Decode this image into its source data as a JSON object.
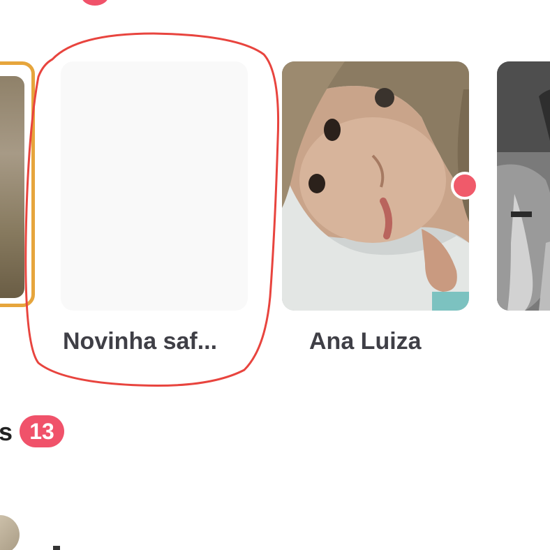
{
  "matches": {
    "cards": [
      {
        "name": "",
        "photo": "blurred-photo"
      },
      {
        "name": "Novinha saf...",
        "photo": "empty"
      },
      {
        "name": "Ana Luiza",
        "photo": "portrait-photo",
        "online": true
      },
      {
        "name": "",
        "photo": "monochrome-photo"
      }
    ]
  },
  "messages_section": {
    "label": "s",
    "count": "13"
  },
  "colors": {
    "accent": "#f0526a",
    "highlight_border": "#e6a53c",
    "annotation": "#e8443e",
    "name_text": "#3f3f46"
  }
}
